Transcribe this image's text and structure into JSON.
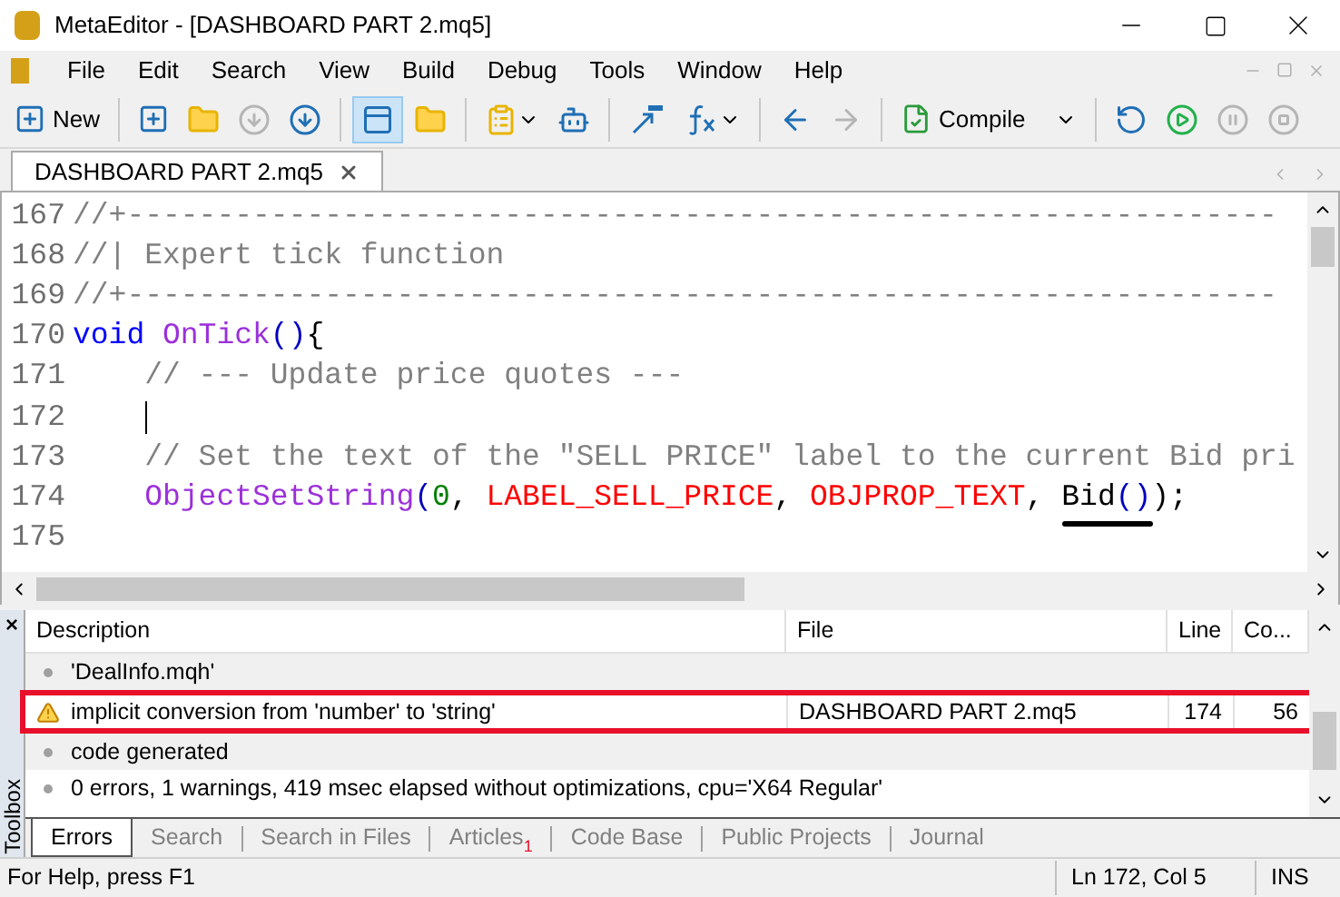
{
  "window": {
    "title": "MetaEditor - [DASHBOARD PART 2.mq5]"
  },
  "menu": [
    "File",
    "Edit",
    "Search",
    "View",
    "Build",
    "Debug",
    "Tools",
    "Window",
    "Help"
  ],
  "toolbar": {
    "new_label": "New",
    "compile_label": "Compile"
  },
  "document_tabs": [
    {
      "label": "DASHBOARD PART 2.mq5",
      "selected": true
    }
  ],
  "editor": {
    "lines": [
      {
        "number": "167",
        "caret": false,
        "tokens": [
          {
            "kind": "comment",
            "text": "//+----------------------------------------------------------------"
          }
        ]
      },
      {
        "number": "168",
        "caret": false,
        "tokens": [
          {
            "kind": "comment",
            "text": "//| Expert tick function"
          }
        ]
      },
      {
        "number": "169",
        "caret": false,
        "tokens": [
          {
            "kind": "comment",
            "text": "//+----------------------------------------------------------------"
          }
        ]
      },
      {
        "number": "170",
        "caret": false,
        "tokens": [
          {
            "kind": "keyword",
            "text": "void"
          },
          {
            "kind": "function",
            "text": "OnTick"
          },
          {
            "kind": "punct",
            "text": "()"
          },
          {
            "kind": "text",
            "text": "{"
          }
        ]
      },
      {
        "number": "171",
        "caret": false,
        "indent": true,
        "tokens": [
          {
            "kind": "comment",
            "text": "// --- Update price quotes ---"
          }
        ]
      },
      {
        "number": "172",
        "caret": true,
        "indent": true
      },
      {
        "number": "173",
        "caret": false,
        "indent": true,
        "tokens": [
          {
            "kind": "comment",
            "text": "// Set the text of the \"SELL PRICE\" label to the current Bid pri"
          }
        ]
      },
      {
        "number": "174",
        "caret": false,
        "indent": true,
        "tokens": [
          {
            "kind": "function",
            "text": "ObjectSetString"
          },
          {
            "kind": "punct",
            "text": "("
          },
          {
            "kind": "number",
            "text": "0"
          },
          {
            "kind": "text",
            "text": ", "
          },
          {
            "kind": "constant",
            "text": "LABEL_SELL_PRICE"
          },
          {
            "kind": "text",
            "text": ", "
          },
          {
            "kind": "constant",
            "text": "OBJPROP_TEXT"
          },
          {
            "kind": "text",
            "text": ", "
          },
          {
            "kind": "underlined",
            "text": "Bid"
          },
          {
            "kind": "punct",
            "text": "()"
          },
          {
            "kind": "text",
            "text": ")"
          },
          {
            "kind": "text",
            "text": ";"
          }
        ]
      },
      {
        "number": "175",
        "caret": false
      }
    ]
  },
  "toolbox": {
    "title": "Toolbox",
    "close": "×",
    "columns": [
      "Description",
      "File",
      "Line",
      "Co..."
    ],
    "rows": [
      {
        "kind": "info",
        "description": "'DealInfo.mqh'",
        "highlighted": false
      },
      {
        "kind": "warning",
        "description": "implicit conversion from 'number' to 'string'",
        "file": "DASHBOARD PART 2.mq5",
        "line": "174",
        "column": "56",
        "highlighted": true
      },
      {
        "kind": "info",
        "description": "code generated",
        "highlighted": false
      },
      {
        "kind": "info",
        "description": "0 errors, 1 warnings, 419 msec elapsed without optimizations, cpu='X64 Regular'",
        "highlighted": false
      }
    ],
    "tabs": [
      {
        "label": "Errors",
        "selected": true
      },
      {
        "label": "Search",
        "selected": false
      },
      {
        "label": "Search in Files",
        "selected": false
      },
      {
        "label": "Articles",
        "badge": "1",
        "selected": false
      },
      {
        "label": "Code Base",
        "selected": false
      },
      {
        "label": "Public Projects",
        "selected": false
      },
      {
        "label": "Journal",
        "selected": false
      }
    ]
  },
  "status_bar": {
    "help": "For Help, press F1",
    "position": "Ln 172, Col 5",
    "mode": "INS"
  }
}
